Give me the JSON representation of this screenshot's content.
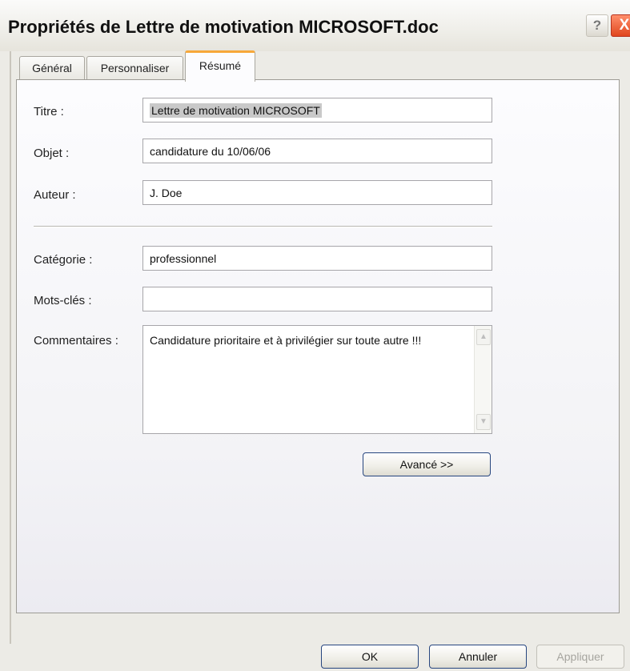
{
  "window": {
    "title": "Propriétés de Lettre de motivation MICROSOFT.doc"
  },
  "titlebar": {
    "help_label": "?",
    "close_label": "X"
  },
  "tabs": [
    {
      "label": "Général",
      "active": false
    },
    {
      "label": "Personnaliser",
      "active": false
    },
    {
      "label": "Résumé",
      "active": true
    }
  ],
  "fields": {
    "titre": {
      "label": "Titre :",
      "value": "Lettre de motivation MICROSOFT",
      "selected": true
    },
    "objet": {
      "label": "Objet :",
      "value": "candidature du 10/06/06"
    },
    "auteur": {
      "label": "Auteur :",
      "value": "J. Doe"
    },
    "categorie": {
      "label": "Catégorie :",
      "value": "professionnel"
    },
    "mots_cles": {
      "label": "Mots-clés :",
      "value": ""
    },
    "commentaires": {
      "label": "Commentaires :",
      "value": "Candidature prioritaire et à privilégier sur toute autre !!!"
    }
  },
  "buttons": {
    "avance": "Avancé >>",
    "ok": "OK",
    "annuler": "Annuler",
    "appliquer": "Appliquer"
  },
  "icons": {
    "scroll_up": "chevron-up-icon",
    "scroll_down": "chevron-down-icon"
  },
  "colors": {
    "active_tab_accent": "#f7a83a",
    "close_button": "#e0461e",
    "button_border": "#27467f"
  }
}
